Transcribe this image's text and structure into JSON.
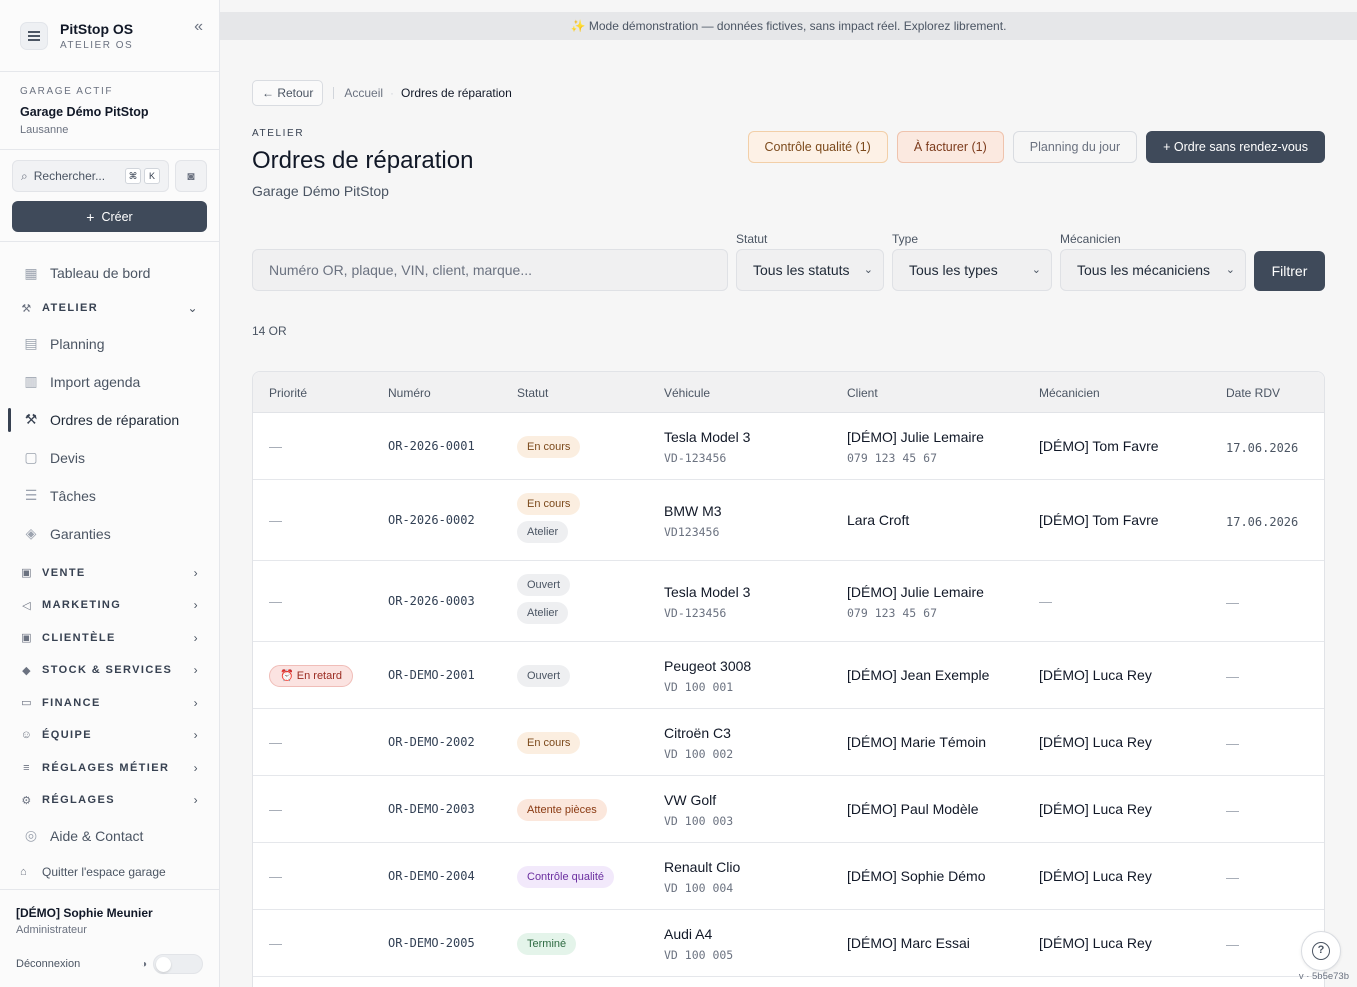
{
  "brand": {
    "name": "PitStop OS",
    "subtitle": "ATELIER OS",
    "collapse_icon": "double-chevron-left-icon"
  },
  "garage": {
    "label": "GARAGE ACTIF",
    "name": "Garage Démo PitStop",
    "city": "Lausanne"
  },
  "search": {
    "placeholder": "Rechercher...",
    "kbd1": "⌘",
    "kbd2": "K"
  },
  "create_label": "Créer",
  "nav": {
    "dashboard": "Tableau de bord",
    "atelier": "ATELIER",
    "planning": "Planning",
    "import": "Import agenda",
    "orders": "Ordres de réparation",
    "quotes": "Devis",
    "tasks": "Tâches",
    "warranties": "Garanties",
    "vente": "VENTE",
    "marketing": "MARKETING",
    "clientele": "CLIENTÈLE",
    "stock": "STOCK & SERVICES",
    "finance": "FINANCE",
    "equipe": "ÉQUIPE",
    "reglages_metier": "RÉGLAGES MÉTIER",
    "reglages": "RÉGLAGES",
    "help": "Aide & Contact",
    "quit": "Quitter l'espace garage"
  },
  "user": {
    "name": "[DÉMO] Sophie Meunier",
    "role": "Administrateur",
    "logout": "Déconnexion"
  },
  "banner": "✨ Mode démonstration — données fictives, sans impact réel. Explorez librement.",
  "breadcrumb": {
    "back": "← Retour",
    "home": "Accueil",
    "current": "Ordres de réparation"
  },
  "header": {
    "label": "ATELIER",
    "title": "Ordres de réparation",
    "subtitle": "Garage Démo PitStop"
  },
  "actions": {
    "qc": "Contrôle qualité (1)",
    "bill": "À facturer (1)",
    "plan": "Planning du jour",
    "new": "+ Ordre sans rendez-vous"
  },
  "filters": {
    "search_placeholder": "Numéro OR, plaque, VIN, client, marque...",
    "status_label": "Statut",
    "status_value": "Tous les statuts",
    "type_label": "Type",
    "type_value": "Tous les types",
    "mech_label": "Mécanicien",
    "mech_value": "Tous les mécaniciens",
    "filter_btn": "Filtrer"
  },
  "count": "14 OR",
  "table": {
    "headers": [
      "Priorité",
      "Numéro",
      "Statut",
      "Véhicule",
      "Client",
      "Mécanicien",
      "Date RDV"
    ],
    "rows": [
      {
        "priority": "—",
        "number": "OR-2026-0001",
        "status1": "En cours",
        "status2": "",
        "vehicle": "Tesla Model 3",
        "plate": "VD-123456",
        "client": "[DÉMO] Julie Lemaire",
        "phone": "079 123 45 67",
        "mechanic": "[DÉMO] Tom Favre",
        "date": "17.06.2026"
      },
      {
        "priority": "—",
        "number": "OR-2026-0002",
        "status1": "En cours",
        "status2": "Atelier",
        "vehicle": "BMW M3",
        "plate": "VD123456",
        "client": "Lara Croft",
        "phone": "",
        "mechanic": "[DÉMO] Tom Favre",
        "date": "17.06.2026"
      },
      {
        "priority": "—",
        "number": "OR-2026-0003",
        "status1": "Ouvert",
        "status2": "Atelier",
        "vehicle": "Tesla Model 3",
        "plate": "VD-123456",
        "client": "[DÉMO] Julie Lemaire",
        "phone": "079 123 45 67",
        "mechanic": "—",
        "date": "—"
      },
      {
        "priority": "En retard",
        "number": "OR-DEMO-2001",
        "status1": "Ouvert",
        "status2": "",
        "vehicle": "Peugeot 3008",
        "plate": "VD 100 001",
        "client": "[DÉMO] Jean Exemple",
        "phone": "",
        "mechanic": "[DÉMO] Luca Rey",
        "date": "—"
      },
      {
        "priority": "—",
        "number": "OR-DEMO-2002",
        "status1": "En cours",
        "status2": "",
        "vehicle": "Citroën C3",
        "plate": "VD 100 002",
        "client": "[DÉMO] Marie Témoin",
        "phone": "",
        "mechanic": "[DÉMO] Luca Rey",
        "date": "—"
      },
      {
        "priority": "—",
        "number": "OR-DEMO-2003",
        "status1": "Attente pièces",
        "status2": "",
        "vehicle": "VW Golf",
        "plate": "VD 100 003",
        "client": "[DÉMO] Paul Modèle",
        "phone": "",
        "mechanic": "[DÉMO] Luca Rey",
        "date": "—"
      },
      {
        "priority": "—",
        "number": "OR-DEMO-2004",
        "status1": "Contrôle qualité",
        "status2": "",
        "vehicle": "Renault Clio",
        "plate": "VD 100 004",
        "client": "[DÉMO] Sophie Démo",
        "phone": "",
        "mechanic": "[DÉMO] Luca Rey",
        "date": "—"
      },
      {
        "priority": "—",
        "number": "OR-DEMO-2005",
        "status1": "Terminé",
        "status2": "",
        "vehicle": "Audi A4",
        "plate": "VD 100 005",
        "client": "[DÉMO] Marc Essai",
        "phone": "",
        "mechanic": "[DÉMO] Luca Rey",
        "date": "—"
      }
    ]
  },
  "version": "v · 5b5e73b"
}
